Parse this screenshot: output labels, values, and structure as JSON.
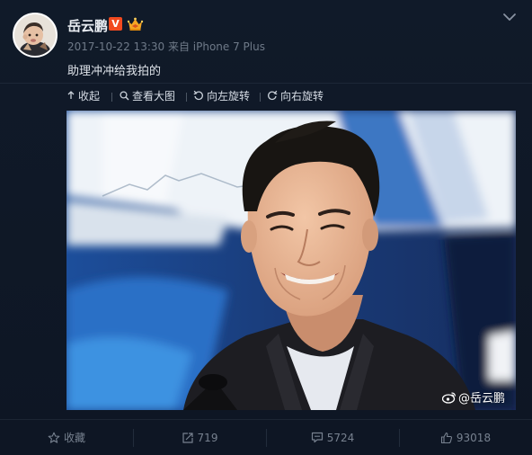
{
  "user": {
    "name": "岳云鹏",
    "vip_badge": "V",
    "avatar_icon": "baby-avatar-icon",
    "crown_icon": "crown-icon"
  },
  "post": {
    "timestamp": "2017-10-22 13:30",
    "source": "来自 iPhone 7 Plus",
    "text": "助理冲冲给我拍的"
  },
  "toolbar": {
    "collapse": "收起",
    "view_large": "查看大图",
    "rotate_left": "向左旋转",
    "rotate_right": "向右旋转"
  },
  "image": {
    "watermark": "@岳云鹏"
  },
  "actions": {
    "favorite": "收藏",
    "repost_count": "719",
    "comment_count": "5724",
    "like_count": "93018"
  },
  "colors": {
    "background": "#0f1725",
    "vip_badge": "#f24a1f",
    "crown": "#f5a623"
  }
}
